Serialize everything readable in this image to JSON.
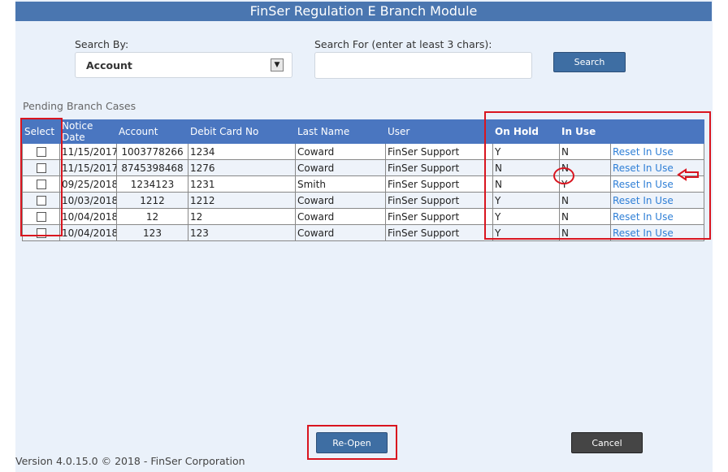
{
  "window": {
    "title": "FinSer Regulation E Branch Module"
  },
  "search": {
    "by_label": "Search By:",
    "by_value": "Account",
    "for_label": "Search For (enter at least 3 chars):",
    "for_value": "",
    "button_label": "Search"
  },
  "section_title": "Pending Branch Cases",
  "table": {
    "columns": [
      "Select",
      "Notice Date",
      "Account",
      "Debit Card No",
      "Last Name",
      "User",
      "On Hold",
      "In Use",
      ""
    ],
    "rows": [
      {
        "notice_date": "11/15/2017",
        "account": "1003778266",
        "debit_card": "1234",
        "last_name": "Coward",
        "user": "FinSer Support",
        "on_hold": "Y",
        "in_use": "N",
        "action": "Reset In Use"
      },
      {
        "notice_date": "11/15/2017",
        "account": "8745398468",
        "debit_card": "1276",
        "last_name": "Coward",
        "user": "FinSer Support",
        "on_hold": "N",
        "in_use": "N",
        "action": "Reset In Use"
      },
      {
        "notice_date": "09/25/2018",
        "account": "1234123",
        "debit_card": "1231",
        "last_name": "Smith",
        "user": "FinSer Support",
        "on_hold": "N",
        "in_use": "Y",
        "action": "Reset In Use"
      },
      {
        "notice_date": "10/03/2018",
        "account": "1212",
        "debit_card": "1212",
        "last_name": "Coward",
        "user": "FinSer Support",
        "on_hold": "Y",
        "in_use": "N",
        "action": "Reset In Use"
      },
      {
        "notice_date": "10/04/2018",
        "account": "12",
        "debit_card": "12",
        "last_name": "Coward",
        "user": "FinSer Support",
        "on_hold": "Y",
        "in_use": "N",
        "action": "Reset In Use"
      },
      {
        "notice_date": "10/04/2018",
        "account": "123",
        "debit_card": "123",
        "last_name": "Coward",
        "user": "FinSer Support",
        "on_hold": "Y",
        "in_use": "N",
        "action": "Reset In Use"
      }
    ]
  },
  "buttons": {
    "reopen": "Re-Open",
    "cancel": "Cancel"
  },
  "footer": {
    "version": "Version 4.0.15.0 © 2018 - FinSer Corporation"
  },
  "colors": {
    "header": "#4a76c0",
    "title_bar": "#4a76b0",
    "annotation": "#d9151f",
    "link": "#2f7fd6"
  }
}
